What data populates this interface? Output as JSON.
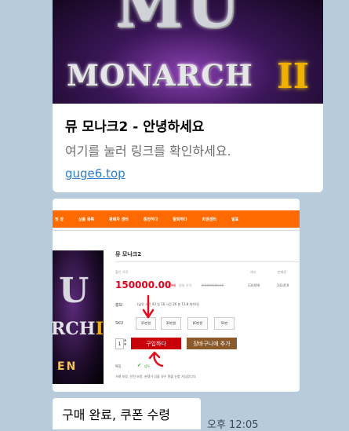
{
  "link_preview": {
    "banner": {
      "logo_big": "MU",
      "logo_word": "MONARCH",
      "logo_roman": "II"
    },
    "title": "뮤 모나크2 - 안녕하세요",
    "description": "여기를 눌러 링크를 확인하세요.",
    "url": "guge6.top"
  },
  "shop_screenshot": {
    "nav": [
      "첫 장",
      "상품 목록",
      "판매자 센터",
      "충전하다",
      "탈퇴하다",
      "회원센터",
      "발표"
    ],
    "image_text": {
      "u": "U",
      "rch": "RCH",
      "roman": "II",
      "en": "EN"
    },
    "product_title": "뮤 모나크2",
    "headers": {
      "price": "할인 가격",
      "stock": "재고",
      "sold": "판매량"
    },
    "price": "150000.00",
    "discount": "1.9배",
    "orig_label": "원래 가격:",
    "orig_price": "W1000000.00",
    "stock": "234098",
    "sold": "342478",
    "promo_label": "홍보",
    "promo_text": "(남은 시간 43 일 16 시간 26 분 11.8 마치다)",
    "sku_label": "SKU",
    "sku_options": [
      "15만원",
      "30만원",
      "60만원",
      "50만"
    ],
    "qty": "1",
    "buy_label": "구입하다",
    "cart_label": "장바구니에 추가",
    "feature_label": "특징",
    "feature_check": "✔",
    "feature_value": "압두",
    "feature_note": "거래 보장, 안전 보장, 분쟁가 있을 경우 환불 신청 가능합니다."
  },
  "message": {
    "text": "구매 완료, 쿠폰 수령",
    "time": "오후 12:05"
  },
  "colors": {
    "chat_bg": "#b7cbdd",
    "nav_orange": "#ff6a00",
    "buy_red": "#c8000a",
    "link_blue": "#2f7dc5"
  }
}
